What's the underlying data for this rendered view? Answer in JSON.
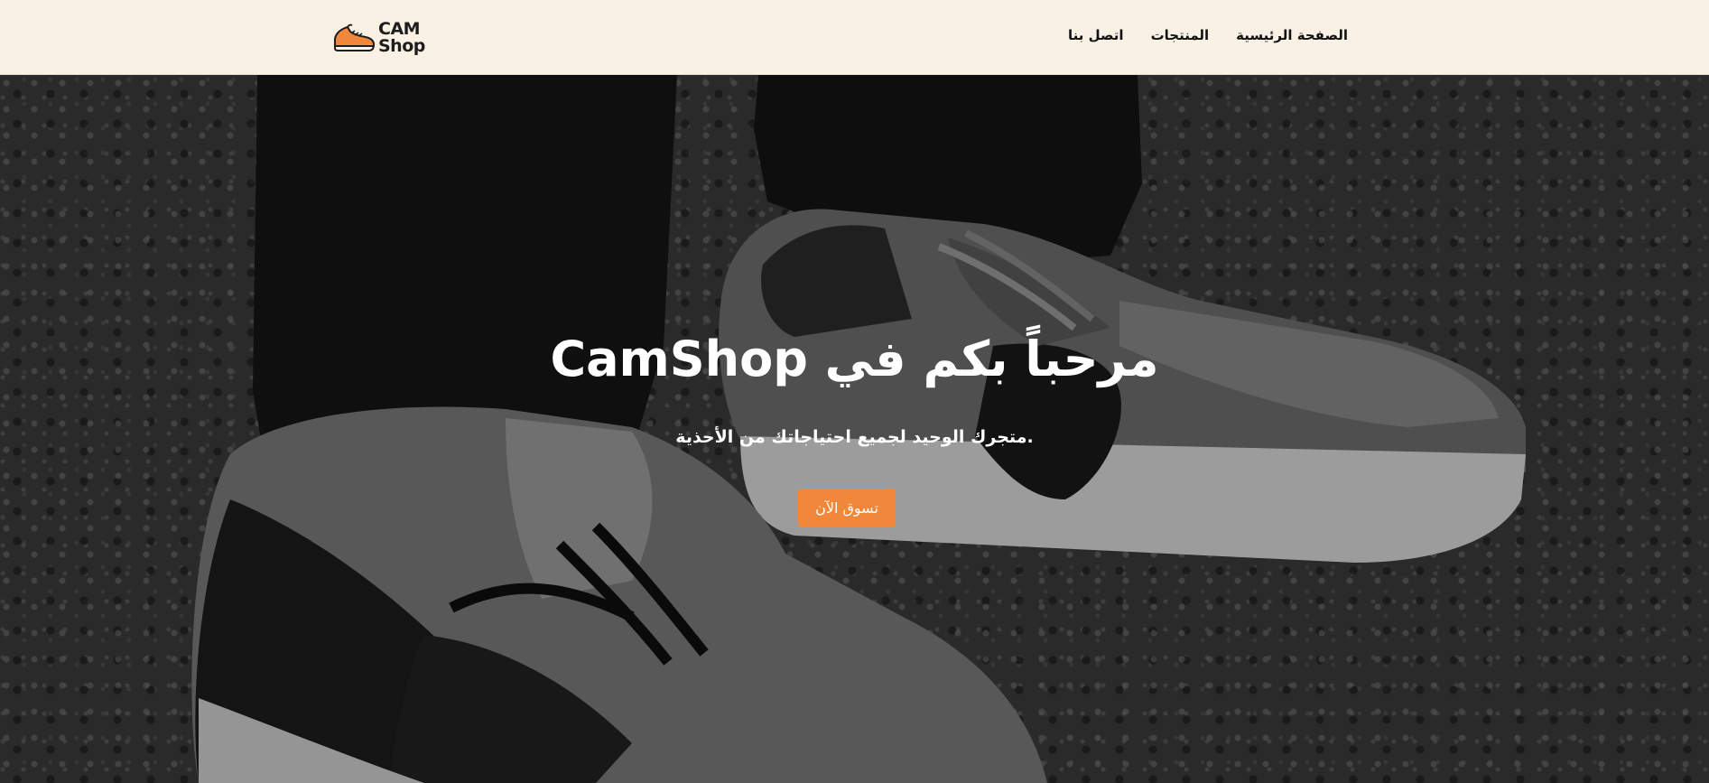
{
  "brand": {
    "name_line1": "CAM",
    "name_line2": "Shop",
    "logo_icon": "sneaker-icon",
    "accent_color": "#f0873a"
  },
  "nav": {
    "items": [
      {
        "label": "الصفحة الرئيسية"
      },
      {
        "label": "المنتجات"
      },
      {
        "label": "اتصل بنا"
      }
    ]
  },
  "hero": {
    "title": "مرحباً بكم في CamShop",
    "subtitle": "متجرك الوحيد لجميع احتياجاتك من الأحذية.",
    "cta_label": "تسوق الآن",
    "background": "photo of black and grey sneakers on asphalt, darkened"
  }
}
